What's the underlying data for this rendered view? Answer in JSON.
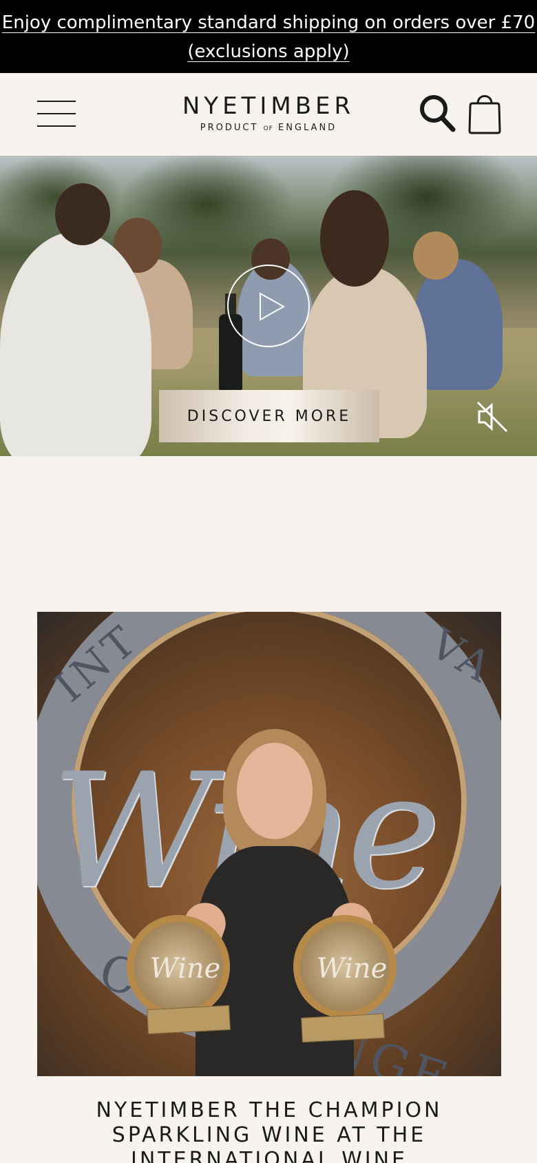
{
  "promo": {
    "text": "Enjoy complimentary standard shipping on orders over £70 (exclusions apply)"
  },
  "header": {
    "brand": "NYETIMBER",
    "tagline": "PRODUCT",
    "tagline_of": "OF",
    "tagline_end": "ENGLAND",
    "menu_icon": "hamburger-menu-icon",
    "search_icon": "search-icon",
    "bag_icon": "shopping-bag-icon"
  },
  "hero": {
    "cta_label": "DISCOVER MORE",
    "play_icon": "play-icon",
    "mute_icon": "speaker-muted-icon"
  },
  "feature": {
    "ring_text_left": "INT",
    "ring_text_right": "VA",
    "ring_text_bottom": "CHALLENGE",
    "wine_script": "Wine",
    "trophy_left": "Wine",
    "trophy_right": "Wine",
    "headline": "NYETIMBER THE CHAMPION SPARKLING WINE AT THE INTERNATIONAL WINE"
  },
  "colors": {
    "promo_bg": "#000000",
    "page_bg": "#f7f3ee",
    "text": "#1a1a1a",
    "cta_gradient_mid": "#f2ece3"
  }
}
